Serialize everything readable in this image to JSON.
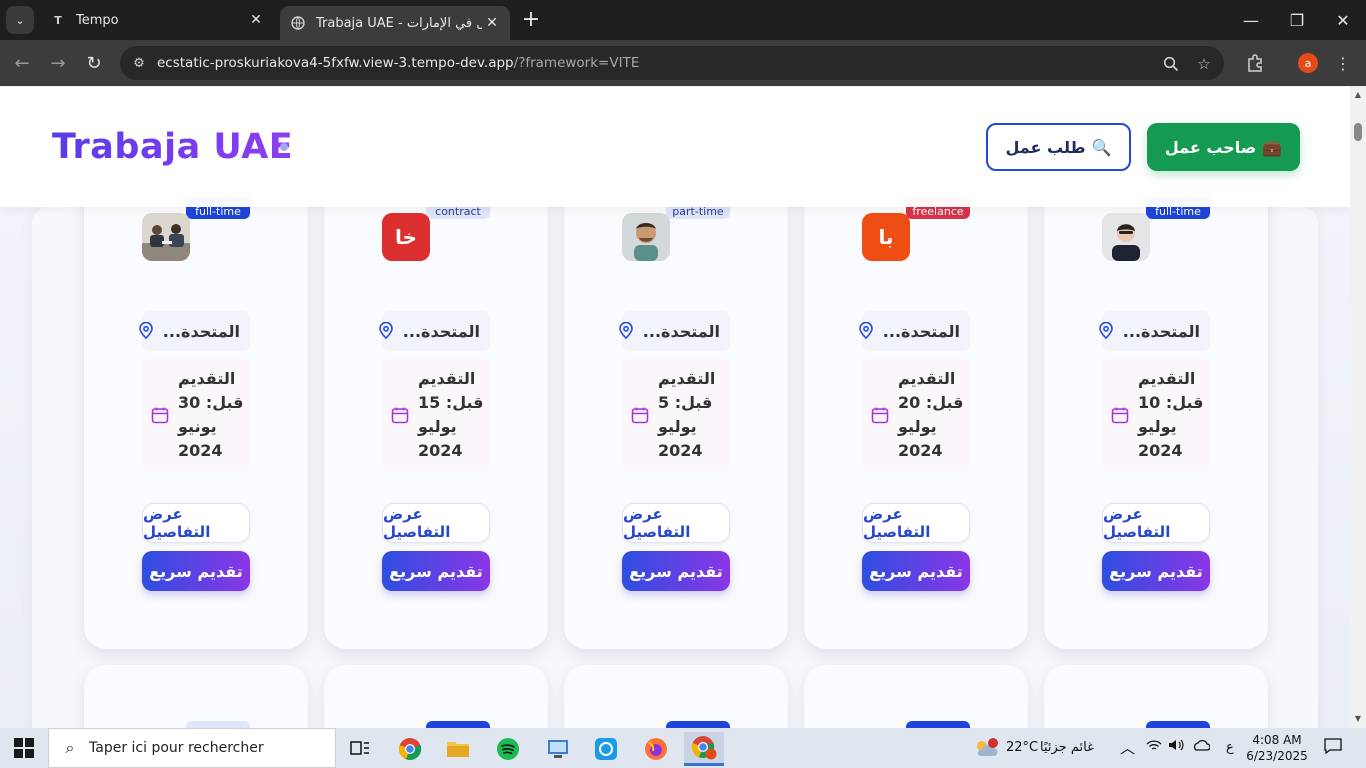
{
  "browser": {
    "tabs": [
      {
        "title": "Tempo",
        "favicon": "tempo-icon",
        "active": false
      },
      {
        "title": "Trabaja UAE - العمل في الإمارات",
        "favicon": "globe-icon",
        "active": true
      }
    ],
    "url_main": "ecstatic-proskuriakova4-5fxfw.view-3.tempo-dev.app",
    "url_rest": "/?framework=VITE",
    "profile_initial": "a"
  },
  "header": {
    "logo": "Trabaja UAE",
    "job_seeker_label": "طلب عمل",
    "job_seeker_icon": "🔍",
    "employer_label": "صاحب عمل",
    "employer_icon": "💼"
  },
  "cards": [
    {
      "badge": "full-time",
      "badge_color": "#1e45d9",
      "logo_type": "photo-meeting",
      "logo_text": "",
      "location": "...المتحدة",
      "deadline": "التقديم\nقبل: 30\nيونيو\n2024",
      "details_label": "عرض التفاصيل",
      "apply_label": "تقديم سريع"
    },
    {
      "badge": "contract",
      "badge_color": "#dfe4f7",
      "logo_type": "text",
      "logo_text": "خا",
      "logo_color": "#dc2f2f",
      "location": "...المتحدة",
      "deadline": "التقديم\nقبل: 15\nيوليو\n2024",
      "details_label": "عرض التفاصيل",
      "apply_label": "تقديم سريع"
    },
    {
      "badge": "part-time",
      "badge_color": "#dfe4f7",
      "logo_type": "photo-man",
      "logo_text": "",
      "location": "...المتحدة",
      "deadline": "التقديم\nقبل: 5\nيوليو\n2024",
      "details_label": "عرض التفاصيل",
      "apply_label": "تقديم سريع"
    },
    {
      "badge": "freelance",
      "badge_color": "#d8324a",
      "logo_type": "text",
      "logo_text": "با",
      "logo_color": "#ee4d14",
      "location": "...المتحدة",
      "deadline": "التقديم\nقبل: 20\nيوليو\n2024",
      "details_label": "عرض التفاصيل",
      "apply_label": "تقديم سريع"
    },
    {
      "badge": "full-time",
      "badge_color": "#1e45d9",
      "logo_type": "photo-woman",
      "logo_text": "",
      "location": "...المتحدة",
      "deadline": "التقديم\nقبل: 10\nيوليو\n2024",
      "details_label": "عرض التفاصيل",
      "apply_label": "تقديم سريع"
    }
  ],
  "taskbar": {
    "search_placeholder": "Taper ici pour rechercher",
    "weather_temp": "22°C",
    "weather_text": "غائم جزئيًا",
    "weather_badge": "1",
    "lang": "ع",
    "time": "4:08 AM",
    "date": "6/23/2025"
  }
}
